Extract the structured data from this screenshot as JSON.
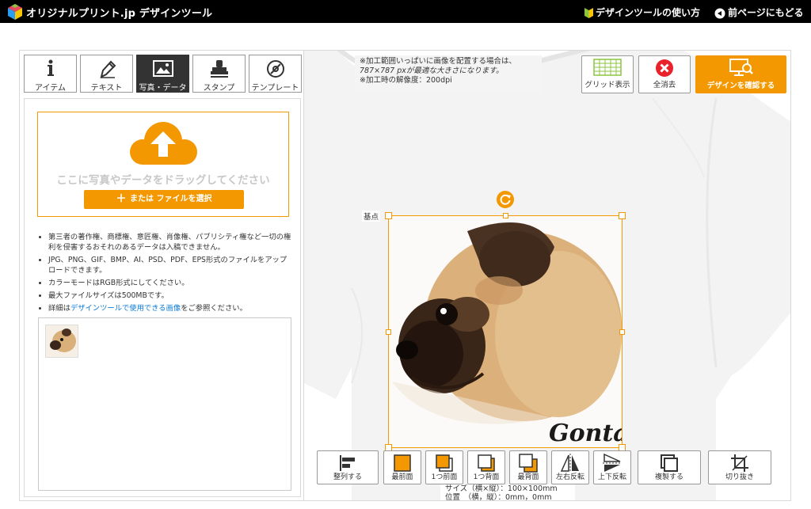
{
  "header": {
    "brand": "オリジナルプリント.jp デザインツール",
    "howto_link": "デザインツールの使い方",
    "back_link": "前ページにもどる"
  },
  "tabs": [
    {
      "label": "アイテム",
      "icon": "info-icon"
    },
    {
      "label": "テキスト",
      "icon": "pen-icon"
    },
    {
      "label": "写真・データ",
      "icon": "image-icon",
      "active": true
    },
    {
      "label": "スタンプ",
      "icon": "stamp-icon"
    },
    {
      "label": "テンプレート",
      "icon": "template-icon"
    }
  ],
  "upload": {
    "drop_text": "ここに写真やデータをドラッグしてください",
    "select_button": "または ファイルを選択"
  },
  "notes": {
    "items": [
      "第三者の著作権、商標権、意匠権、肖像権、パブリシティ権など一切の権利を侵害するおそれのあるデータは入稿できません。",
      "JPG、PNG、GIF、BMP、AI、PSD、PDF、EPS形式のファイルをアップロードできます。",
      "カラーモードはRGB形式にしてください。",
      "最大ファイルサイズは500MBです。"
    ],
    "last_prefix": "詳細は",
    "last_link": "デザインツールで使用できる画像",
    "last_suffix": "をご参照ください。"
  },
  "canvas": {
    "info_line1": "※加工範囲いっぱいに画像を配置する場合は、",
    "info_line2": "787×787 pxが最適な大きさになります。",
    "info_line3": "※加工時の解像度：200dpi",
    "grid_button": "グリッド表示",
    "clear_button": "全消去",
    "confirm_button": "デザインを確認する",
    "anchor_label": "基点",
    "design_text": "Gonta",
    "size_line": "サイズ（横×縦）：100×100mm",
    "position_line": "位置　（横，縦）：0mm，0mm"
  },
  "toolbar": {
    "align": "整列する",
    "front": "最前面",
    "forward": "1つ前面",
    "backward": "1つ背面",
    "back": "最背面",
    "flip_h": "左右反転",
    "flip_v": "上下反転",
    "duplicate": "複製する",
    "crop": "切り抜き"
  },
  "colors": {
    "accent": "#f39800",
    "header_bg": "#000000",
    "clear_red": "#e8212b",
    "link_blue": "#0a7bd8",
    "grid_green": "#8cc63f"
  }
}
